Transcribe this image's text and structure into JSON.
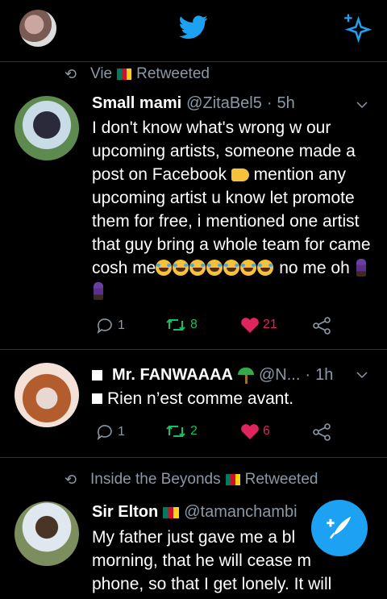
{
  "header": {
    "avatar_icon": "user-avatar",
    "logo_icon": "twitter-bird-icon",
    "sparkle_icon": "sparkle-icon",
    "brand_color": "#1da1f2"
  },
  "tweets": [
    {
      "retweet_by": "Vie",
      "retweet_suffix": "Retweeted",
      "name": "Small mami",
      "handle": "@ZitaBel5",
      "dot": "·",
      "time": "5h",
      "text_1": "I don't know what's wrong w our upcoming artists, someone made a post on Facebook",
      "text_2": "mention any upcoming artist u know let promote them for free, i mentioned one artist that guy bring a whole team for came cosh me",
      "text_3": "no me oh",
      "replies": "1",
      "retweets": "8",
      "likes": "21"
    },
    {
      "name": "Mr. FANWAAAA",
      "handle": "@N...",
      "dot": "·",
      "time": "1h",
      "text": "Rien n’est comme avant.",
      "replies": "1",
      "retweets": "2",
      "likes": "6"
    },
    {
      "retweet_by": "Inside the Beyonds",
      "retweet_suffix": "Retweeted",
      "name": "Sir Elton",
      "handle": "@tamanchambi",
      "text": "My father just gave me a bl morning, that he will cease m phone, so that I get lonely. It will"
    }
  ],
  "colors": {
    "retweet_green": "#17bf63",
    "like_red": "#e0245e",
    "secondary_text": "#8b98a5",
    "divider": "#2f3336"
  },
  "compose": {
    "icon": "compose-feather-icon"
  }
}
